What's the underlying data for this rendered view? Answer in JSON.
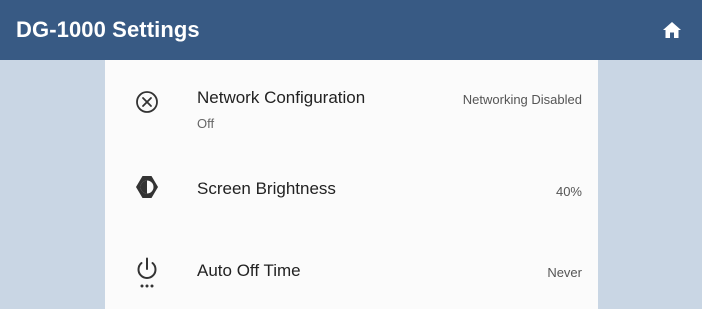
{
  "header": {
    "title": "DG-1000 Settings",
    "home_icon": "home-icon",
    "background": "#385a84"
  },
  "settings": [
    {
      "icon": "close-circle-icon",
      "label": "Network Configuration",
      "sublabel": "Off",
      "value": "Networking Disabled"
    },
    {
      "icon": "brightness-icon",
      "label": "Screen Brightness",
      "value": "40%"
    },
    {
      "icon": "power-icon",
      "label": "Auto Off Time",
      "value": "Never"
    }
  ],
  "colors": {
    "side_background": "#c9d6e4",
    "panel_background": "#fbfbfb"
  }
}
